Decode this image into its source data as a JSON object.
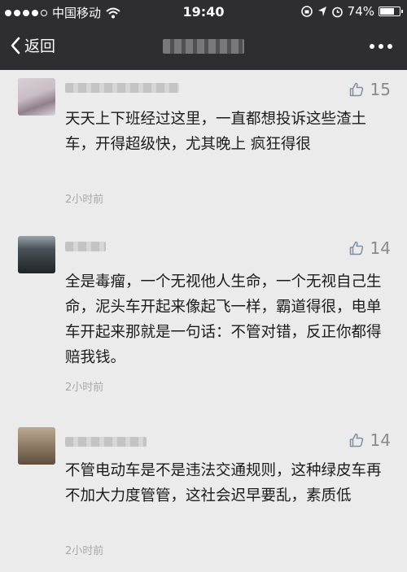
{
  "status": {
    "carrier": "中国移动",
    "time": "19:40",
    "battery": "74%",
    "battery_level": 0.74
  },
  "nav": {
    "back_label": "返回"
  },
  "comments": [
    {
      "likes": "15",
      "text": "天天上下班经过这里，一直都想投诉这些渣土车，开得超级快，尤其晚上 疯狂得很",
      "time": "2小时前"
    },
    {
      "likes": "14",
      "text": "全是毒瘤，一个无视他人生命，一个无视自己生命，泥头车开起来像起飞一样，霸道得很，电单车开起来那就是一句话：不管对错，反正你都得赔我钱。",
      "time": "2小时前"
    },
    {
      "likes": "14",
      "text": "不管电动车是不是违法交通规则，这种绿皮车再不加大力度管管，这社会迟早要乱，素质低",
      "time": "2小时前"
    }
  ]
}
